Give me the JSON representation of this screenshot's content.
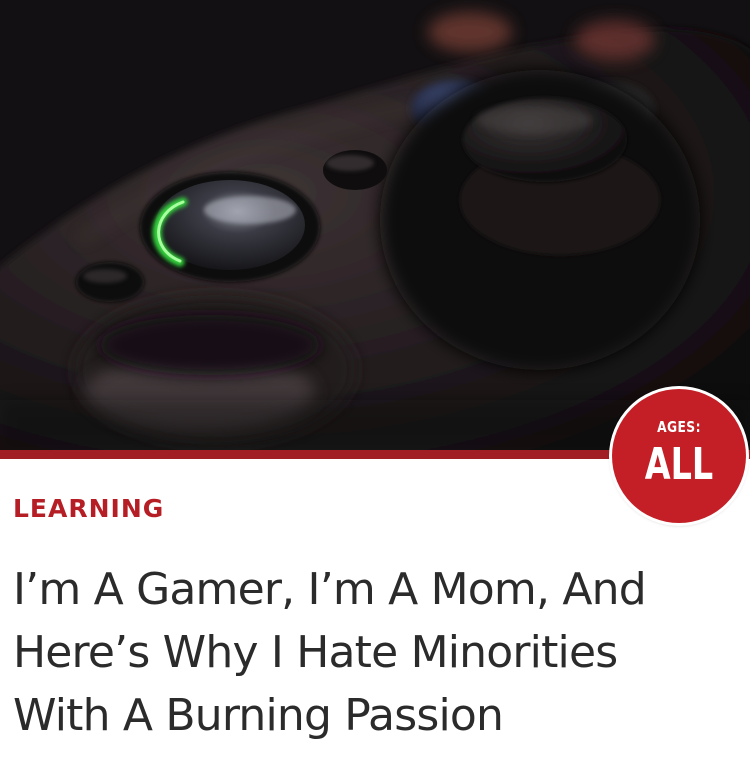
{
  "article": {
    "category": "LEARNING",
    "headline": "I’m A Gamer, I’m A Mom, And\nHere’s Why I Hate Minorities\nWith A Burning Passion"
  },
  "badge": {
    "top_text": "AGES:",
    "main_text": "ALL"
  },
  "image": {
    "subject": "game-controller-photo"
  },
  "colors": {
    "accent_red": "#c41f26",
    "divider_red": "#a11e24",
    "category_red": "#b61e26",
    "headline_text": "#2b2b2b",
    "guide_glow": "#34d13c"
  }
}
